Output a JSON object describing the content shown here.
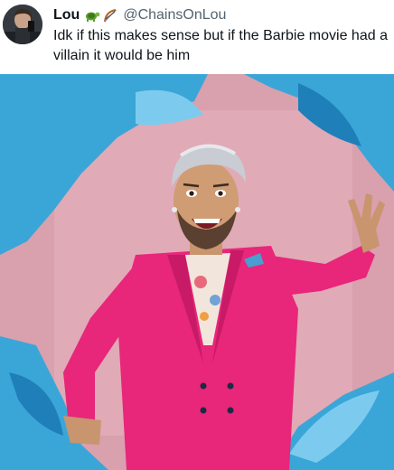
{
  "tweet": {
    "author": {
      "display_name": "Lou",
      "handle": "@ChainsOnLou",
      "badges": [
        "turtle-emoji",
        "bow-and-arrow-emoji"
      ]
    },
    "text": "Idk if this makes sense but if the Barbie movie had a villain it would be him"
  },
  "photo": {
    "subject": "man in hot-pink suit bursting through torn blue paper",
    "colors": {
      "background": "#d9a0ad",
      "paper": "#3aa6d8",
      "suit": "#e8267a",
      "hair": "#c9ccd2"
    }
  }
}
